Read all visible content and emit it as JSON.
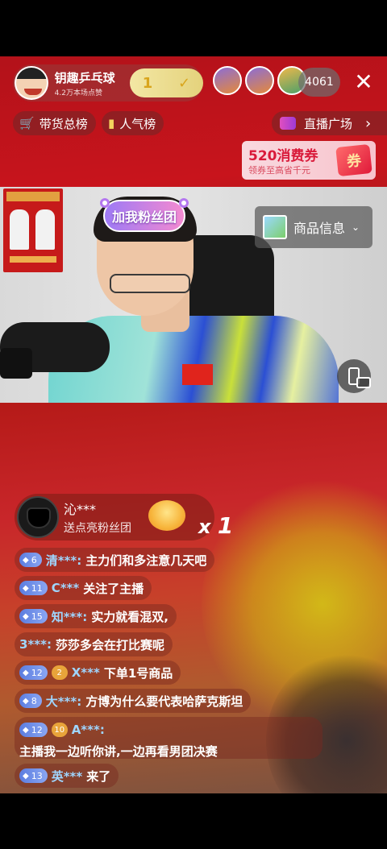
{
  "host": {
    "name": "钥趣乒乓球",
    "likes": "4.2万本场点赞",
    "follow_badge_count": "1"
  },
  "viewers": {
    "count": "4061"
  },
  "close_symbol": "✕",
  "tabs": {
    "sales_rank": "带货总榜",
    "popularity_rank": "人气榜",
    "live_square": "直播广场"
  },
  "coupon": {
    "title": "520消费券",
    "subtitle": "领券至高省千元",
    "tag": "券"
  },
  "video": {
    "fan_badge": "加我粉丝团",
    "product_info": "商品信息"
  },
  "gift": {
    "user": "沁***",
    "action": "送点亮粉丝团",
    "combo_prefix": "x",
    "combo_count": "1"
  },
  "comments": [
    {
      "level": "6",
      "user": "清***:",
      "text": "主力们和多注意几天吧"
    },
    {
      "level": "11",
      "user": "C***",
      "text": "关注了主播"
    },
    {
      "level": "15",
      "user": "知***:",
      "text": "实力就看混双,"
    },
    {
      "level": "",
      "user": "3***:",
      "text": "莎莎多会在打比赛呢"
    },
    {
      "level": "12",
      "fan": "2",
      "user": "X***",
      "text": "下单1号商品"
    },
    {
      "level": "8",
      "user": "大***:",
      "text": "方博为什么要代表哈萨克斯坦"
    },
    {
      "level": "12",
      "fan": "10",
      "user": "A***:",
      "text": "主播我一边听你讲,一边再看男团决赛"
    },
    {
      "level": "13",
      "user": "英***",
      "text": "来了"
    }
  ],
  "colors": {
    "accent_red": "#c8141c",
    "level_blue": "#5b7de0",
    "coupon_red": "#d91a3a"
  }
}
